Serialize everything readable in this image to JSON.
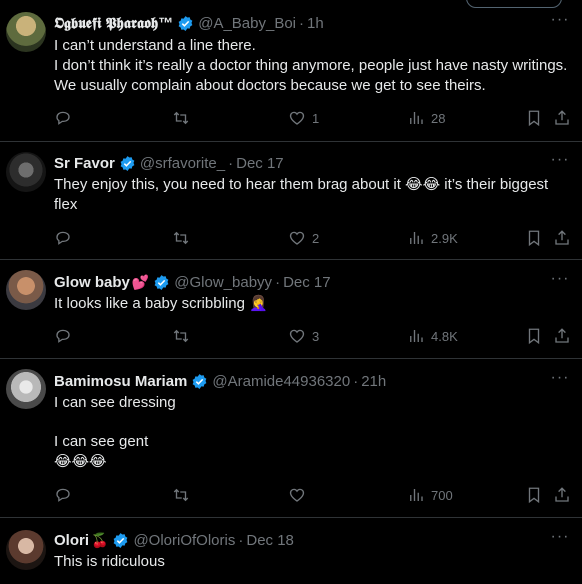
{
  "tweets": [
    {
      "name": "𝕺𝖌𝖇𝖚𝖊𝖋𝖎 𝕻𝖍𝖆𝖗𝖆𝖔𝖍™",
      "handle": "@A_Baby_Boi",
      "time": "1h",
      "lines": [
        "I can’t understand a line there.",
        "I don’t think it’s really a doctor thing anymore, people just have nasty writings. We usually complain about doctors because we get to see theirs."
      ],
      "replies": "",
      "reposts": "",
      "likes": "1",
      "views": "28"
    },
    {
      "name": "Sr Favor",
      "handle": "@srfavorite_",
      "time": "Dec 17",
      "lines": [
        "They enjoy this, you need to hear them brag about it 😂😂 it’s their biggest flex"
      ],
      "replies": "",
      "reposts": "",
      "likes": "2",
      "views": "2.9K"
    },
    {
      "name": "Glow baby",
      "name_emoji": "💕",
      "handle": "@Glow_babyy",
      "time": "Dec 17",
      "lines": [
        "It looks like a baby scribbling 🤦‍♀️"
      ],
      "replies": "",
      "reposts": "",
      "likes": "3",
      "views": "4.8K"
    },
    {
      "name": "Bamimosu Mariam",
      "handle": "@Aramide44936320",
      "time": "21h",
      "lines": [
        "I can see dressing",
        "",
        "I can see gent",
        "😂😂😂"
      ],
      "replies": "",
      "reposts": "",
      "likes": "",
      "views": "700"
    },
    {
      "name": "Olori",
      "name_emoji": "🍒",
      "handle": "@OloriOfOloris",
      "time": "Dec 18",
      "lines": [
        "This is ridiculous"
      ]
    }
  ],
  "icons": {
    "verified_color": "#1d9bf0",
    "reply": "reply-icon",
    "repost": "repost-icon",
    "like": "heart-icon",
    "views": "views-icon",
    "bookmark": "bookmark-icon",
    "share": "share-icon",
    "more": "more-icon"
  }
}
